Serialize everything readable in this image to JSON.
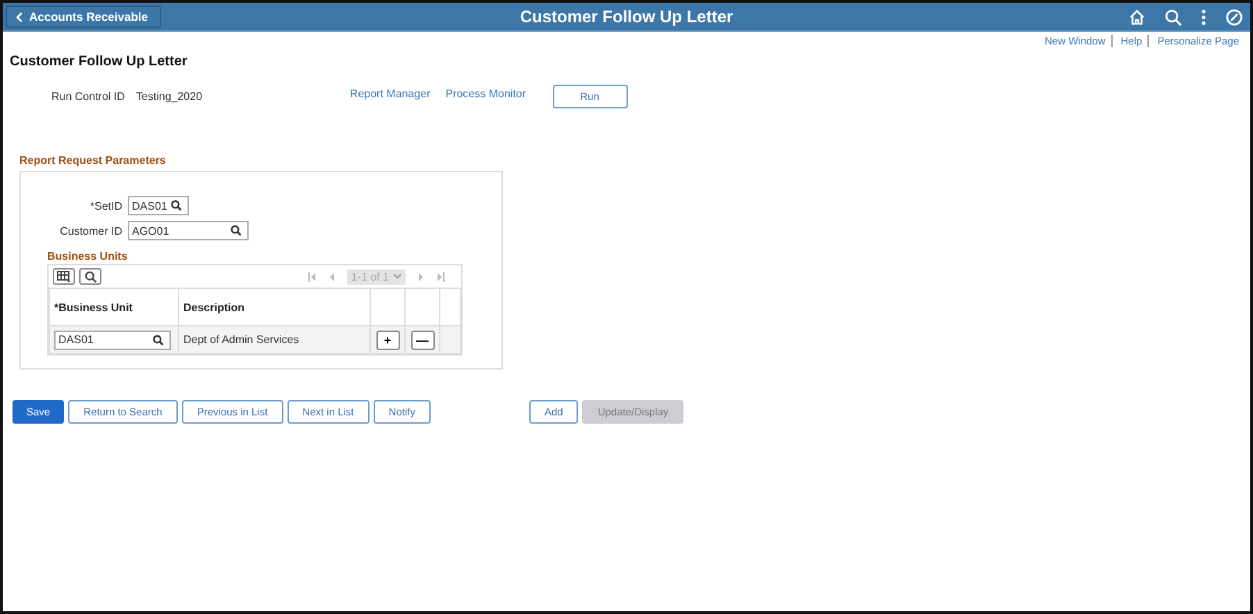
{
  "header": {
    "back_label": "Accounts Receivable",
    "title": "Customer Follow Up Letter"
  },
  "top_links": [
    "New Window",
    "Help",
    "Personalize Page"
  ],
  "page_title": "Customer Follow Up Letter",
  "run_control": {
    "label": "Run Control ID",
    "value": "Testing_2020",
    "links": [
      "Report Manager",
      "Process Monitor"
    ],
    "run_button": "Run"
  },
  "section_title": "Report Request Parameters",
  "fields": [
    {
      "label": "*SetID",
      "value": "DAS01",
      "wide": false
    },
    {
      "label": "Customer ID",
      "value": "AGO01",
      "wide": true
    }
  ],
  "grid": {
    "title": "Business Units",
    "pager": "1-1 of 1",
    "columns": [
      "*Business Unit",
      "Description"
    ],
    "rows": [
      {
        "business_unit": "DAS01",
        "description": "Dept of Admin Services",
        "add_label": "+",
        "delete_label": "—"
      }
    ]
  },
  "buttons": [
    {
      "label": "Save",
      "kind": "primary"
    },
    {
      "label": "Return to Search",
      "kind": "secondary"
    },
    {
      "label": "Previous in List",
      "kind": "secondary"
    },
    {
      "label": "Next in List",
      "kind": "secondary"
    },
    {
      "label": "Notify",
      "kind": "secondary"
    },
    {
      "label": "Add",
      "kind": "secondary",
      "gap": true
    },
    {
      "label": "Update/Display",
      "kind": "disabled"
    }
  ]
}
